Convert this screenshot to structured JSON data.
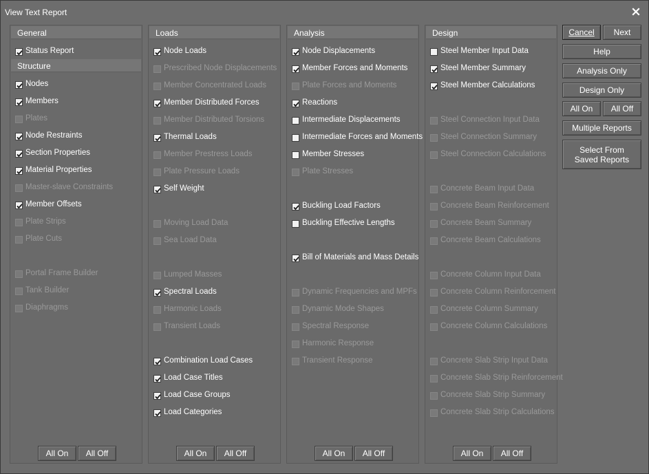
{
  "window": {
    "title": "View Text Report"
  },
  "panels": [
    {
      "sections": [
        {
          "header": "General",
          "items": [
            {
              "label": "Status Report",
              "checked": true,
              "enabled": true,
              "row": 0
            }
          ]
        },
        {
          "header": "Structure",
          "items": [
            {
              "label": "Nodes",
              "checked": true,
              "enabled": true,
              "row": 0
            },
            {
              "label": "Members",
              "checked": true,
              "enabled": true,
              "row": 1
            },
            {
              "label": "Plates",
              "checked": false,
              "enabled": false,
              "row": 2
            },
            {
              "label": "Node Restraints",
              "checked": true,
              "enabled": true,
              "row": 3
            },
            {
              "label": "Section Properties",
              "checked": true,
              "enabled": true,
              "row": 4
            },
            {
              "label": "Material Properties",
              "checked": true,
              "enabled": true,
              "row": 5
            },
            {
              "label": "Master-slave Constraints",
              "checked": false,
              "enabled": false,
              "row": 6
            },
            {
              "label": "Member Offsets",
              "checked": true,
              "enabled": true,
              "row": 7
            },
            {
              "label": "Plate Strips",
              "checked": false,
              "enabled": false,
              "row": 8
            },
            {
              "label": "Plate Cuts",
              "checked": false,
              "enabled": false,
              "row": 9
            },
            {
              "label": "Portal Frame Builder",
              "checked": false,
              "enabled": false,
              "row": 11
            },
            {
              "label": "Tank Builder",
              "checked": false,
              "enabled": false,
              "row": 12
            },
            {
              "label": "Diaphragms",
              "checked": false,
              "enabled": false,
              "row": 13
            }
          ]
        }
      ],
      "all_on": "All On",
      "all_off": "All Off"
    },
    {
      "sections": [
        {
          "header": "Loads",
          "items": [
            {
              "label": "Node Loads",
              "checked": true,
              "enabled": true,
              "row": 0
            },
            {
              "label": "Prescribed Node Displacements",
              "checked": false,
              "enabled": false,
              "row": 1
            },
            {
              "label": "Member Concentrated Loads",
              "checked": false,
              "enabled": false,
              "row": 2
            },
            {
              "label": "Member Distributed Forces",
              "checked": true,
              "enabled": true,
              "row": 3
            },
            {
              "label": "Member Distributed Torsions",
              "checked": false,
              "enabled": false,
              "row": 4
            },
            {
              "label": "Thermal Loads",
              "checked": true,
              "enabled": true,
              "row": 5
            },
            {
              "label": "Member Prestress Loads",
              "checked": false,
              "enabled": false,
              "row": 6
            },
            {
              "label": "Plate Pressure Loads",
              "checked": false,
              "enabled": false,
              "row": 7
            },
            {
              "label": "Self Weight",
              "checked": true,
              "enabled": true,
              "row": 8
            },
            {
              "label": "Moving Load Data",
              "checked": false,
              "enabled": false,
              "row": 10
            },
            {
              "label": "Sea Load Data",
              "checked": false,
              "enabled": false,
              "row": 11
            },
            {
              "label": "Lumped Masses",
              "checked": false,
              "enabled": false,
              "row": 13
            },
            {
              "label": "Spectral Loads",
              "checked": true,
              "enabled": true,
              "row": 14
            },
            {
              "label": "Harmonic Loads",
              "checked": false,
              "enabled": false,
              "row": 15
            },
            {
              "label": "Transient Loads",
              "checked": false,
              "enabled": false,
              "row": 16
            },
            {
              "label": "Combination Load Cases",
              "checked": true,
              "enabled": true,
              "row": 18
            },
            {
              "label": "Load Case Titles",
              "checked": true,
              "enabled": true,
              "row": 19
            },
            {
              "label": "Load Case Groups",
              "checked": true,
              "enabled": true,
              "row": 20
            },
            {
              "label": "Load Categories",
              "checked": true,
              "enabled": true,
              "row": 21
            }
          ]
        }
      ],
      "all_on": "All On",
      "all_off": "All Off"
    },
    {
      "sections": [
        {
          "header": "Analysis",
          "items": [
            {
              "label": "Node Displacements",
              "checked": true,
              "enabled": true,
              "row": 0
            },
            {
              "label": "Member Forces and Moments",
              "checked": true,
              "enabled": true,
              "row": 1
            },
            {
              "label": "Plate Forces and Moments",
              "checked": false,
              "enabled": false,
              "row": 2
            },
            {
              "label": "Reactions",
              "checked": true,
              "enabled": true,
              "row": 3
            },
            {
              "label": "Intermediate Displacements",
              "checked": false,
              "enabled": true,
              "row": 4
            },
            {
              "label": "Intermediate Forces and Moments",
              "checked": false,
              "enabled": true,
              "row": 5
            },
            {
              "label": "Member Stresses",
              "checked": false,
              "enabled": true,
              "row": 6
            },
            {
              "label": "Plate Stresses",
              "checked": false,
              "enabled": false,
              "row": 7
            },
            {
              "label": "Buckling Load Factors",
              "checked": true,
              "enabled": true,
              "row": 9
            },
            {
              "label": "Buckling Effective Lengths",
              "checked": false,
              "enabled": true,
              "row": 10
            },
            {
              "label": "Bill of Materials and Mass Details",
              "checked": true,
              "enabled": true,
              "row": 12
            },
            {
              "label": "Dynamic Frequencies and MPFs",
              "checked": false,
              "enabled": false,
              "row": 14
            },
            {
              "label": "Dynamic Mode Shapes",
              "checked": false,
              "enabled": false,
              "row": 15
            },
            {
              "label": "Spectral Response",
              "checked": false,
              "enabled": false,
              "row": 16
            },
            {
              "label": "Harmonic Response",
              "checked": false,
              "enabled": false,
              "row": 17
            },
            {
              "label": "Transient Response",
              "checked": false,
              "enabled": false,
              "row": 18
            }
          ]
        }
      ],
      "all_on": "All On",
      "all_off": "All Off"
    },
    {
      "sections": [
        {
          "header": "Design",
          "items": [
            {
              "label": "Steel Member Input Data",
              "checked": false,
              "enabled": true,
              "row": 0
            },
            {
              "label": "Steel Member Summary",
              "checked": true,
              "enabled": true,
              "row": 1
            },
            {
              "label": "Steel Member Calculations",
              "checked": true,
              "enabled": true,
              "row": 2
            },
            {
              "label": "Steel Connection Input Data",
              "checked": false,
              "enabled": false,
              "row": 4
            },
            {
              "label": "Steel Connection Summary",
              "checked": false,
              "enabled": false,
              "row": 5
            },
            {
              "label": "Steel Connection Calculations",
              "checked": false,
              "enabled": false,
              "row": 6
            },
            {
              "label": "Concrete Beam Input Data",
              "checked": false,
              "enabled": false,
              "row": 8
            },
            {
              "label": "Concrete Beam Reinforcement",
              "checked": false,
              "enabled": false,
              "row": 9
            },
            {
              "label": "Concrete Beam Summary",
              "checked": false,
              "enabled": false,
              "row": 10
            },
            {
              "label": "Concrete Beam Calculations",
              "checked": false,
              "enabled": false,
              "row": 11
            },
            {
              "label": "Concrete Column Input Data",
              "checked": false,
              "enabled": false,
              "row": 13
            },
            {
              "label": "Concrete Column Reinforcement",
              "checked": false,
              "enabled": false,
              "row": 14
            },
            {
              "label": "Concrete Column Summary",
              "checked": false,
              "enabled": false,
              "row": 15
            },
            {
              "label": "Concrete Column Calculations",
              "checked": false,
              "enabled": false,
              "row": 16
            },
            {
              "label": "Concrete Slab Strip Input Data",
              "checked": false,
              "enabled": false,
              "row": 18
            },
            {
              "label": "Concrete Slab Strip Reinforcement",
              "checked": false,
              "enabled": false,
              "row": 19
            },
            {
              "label": "Concrete Slab Strip Summary",
              "checked": false,
              "enabled": false,
              "row": 20
            },
            {
              "label": "Concrete Slab Strip Calculations",
              "checked": false,
              "enabled": false,
              "row": 21
            }
          ]
        }
      ],
      "all_on": "All On",
      "all_off": "All Off"
    }
  ],
  "side_buttons": {
    "cancel": "Cancel",
    "next": "Next",
    "help": "Help",
    "analysis_only": "Analysis Only",
    "design_only": "Design Only",
    "all_on": "All On",
    "all_off": "All Off",
    "multiple_reports": "Multiple Reports",
    "select_from_saved_line1": "Select From",
    "select_from_saved_line2": "Saved Reports"
  },
  "colors": {
    "window_bg": "#6d6d6d",
    "panel_border": "#5a5a5a",
    "text": "#ffffff",
    "disabled_text": "#9a9a9a"
  }
}
